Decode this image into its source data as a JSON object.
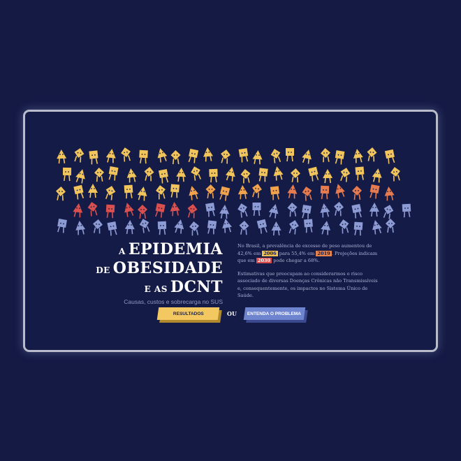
{
  "title": {
    "line1_small": "A",
    "line1_big": "EPIDEMIA",
    "line2_small": "DE",
    "line2_big": "OBESIDADE",
    "line3_small": "E AS",
    "line3_big": "DCNT",
    "subtitle": "Causas, custos e sobrecarga no SUS"
  },
  "paragraph1": {
    "p1": "No Brasil, a prevalência de excesso de peso aumentou de 42,6% em",
    "y2006": "2006",
    "p2": "para 55,4% em",
    "y2019": "2019",
    "p3": ". Projeções indicam que em",
    "y2030": "2030",
    "p4": "pode chegar a 68%."
  },
  "paragraph2": "Estimativas que preocupam ao considerarmos o risco associado de diversas Doenças Crônicas não Transmissíveis e, consequentemente, os impactos no Sistema Único de Saúde.",
  "buttons": {
    "resultados": "RESULTADOS",
    "ou": "OU",
    "entenda": "ENTENDA O PROBLEMA"
  },
  "colors": {
    "background": "#141a44",
    "figure_rows": [
      "#f2c55c",
      "#f0a24c",
      "#e57b4f",
      "#d9504f",
      "#8d9bd4"
    ],
    "highlight_2006": "#f1c24f",
    "highlight_2019": "#e8834a",
    "highlight_2030": "#d84a4a"
  },
  "figure_shapes": [
    "square",
    "diamond",
    "triangle"
  ]
}
